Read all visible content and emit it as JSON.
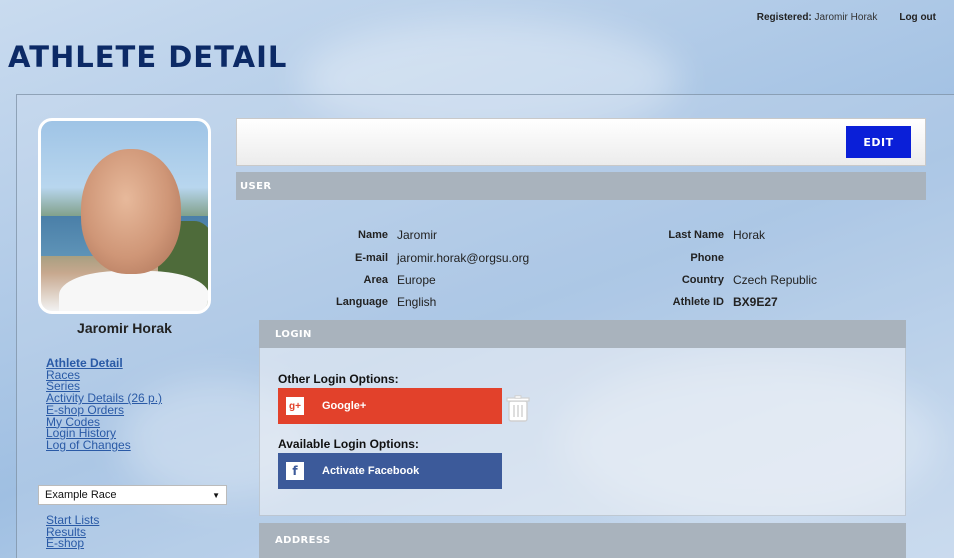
{
  "header": {
    "registered_label": "Registered:",
    "registered_user": "Jaromir Horak",
    "logout": "Log out",
    "page_title": "ATHLETE DETAIL"
  },
  "sidebar": {
    "athlete_name": "Jaromir Horak",
    "nav_items": [
      {
        "label": "Athlete Detail",
        "active": true
      },
      {
        "label": "Races"
      },
      {
        "label": "Series"
      },
      {
        "label": "Activity Details (26 p.)"
      },
      {
        "label": "E-shop Orders"
      },
      {
        "label": "My Codes"
      },
      {
        "label": "Login History"
      },
      {
        "label": "Log of Changes"
      }
    ],
    "race_select": {
      "selected": "Example Race"
    },
    "race_nav": [
      {
        "label": "Start Lists"
      },
      {
        "label": "Results"
      },
      {
        "label": "E-shop"
      }
    ]
  },
  "toolbar": {
    "edit_label": "EDIT"
  },
  "user_section": {
    "title": "USER",
    "fields": {
      "name_label": "Name",
      "name_value": "Jaromir",
      "email_label": "E-mail",
      "email_value": "jaromir.horak@orgsu.org",
      "area_label": "Area",
      "area_value": "Europe",
      "language_label": "Language",
      "language_value": "English",
      "lastname_label": "Last Name",
      "lastname_value": "Horak",
      "phone_label": "Phone",
      "phone_value": "",
      "country_label": "Country",
      "country_value": "Czech Republic",
      "athleteid_label": "Athlete ID",
      "athleteid_value": "BX9E27"
    }
  },
  "login_section": {
    "title": "LOGIN",
    "other_options_label": "Other Login Options:",
    "google_label": "Google+",
    "available_options_label": "Available Login Options:",
    "facebook_label": "Activate Facebook"
  },
  "address_section": {
    "title": "ADDRESS"
  },
  "colors": {
    "title_navy": "#0c2a66",
    "edit_blue": "#0a1fd8",
    "google_red": "#e2412b",
    "facebook_blue": "#3c5a9a",
    "section_gray": "#a9b3bd",
    "link_blue": "#2a5aa6"
  }
}
